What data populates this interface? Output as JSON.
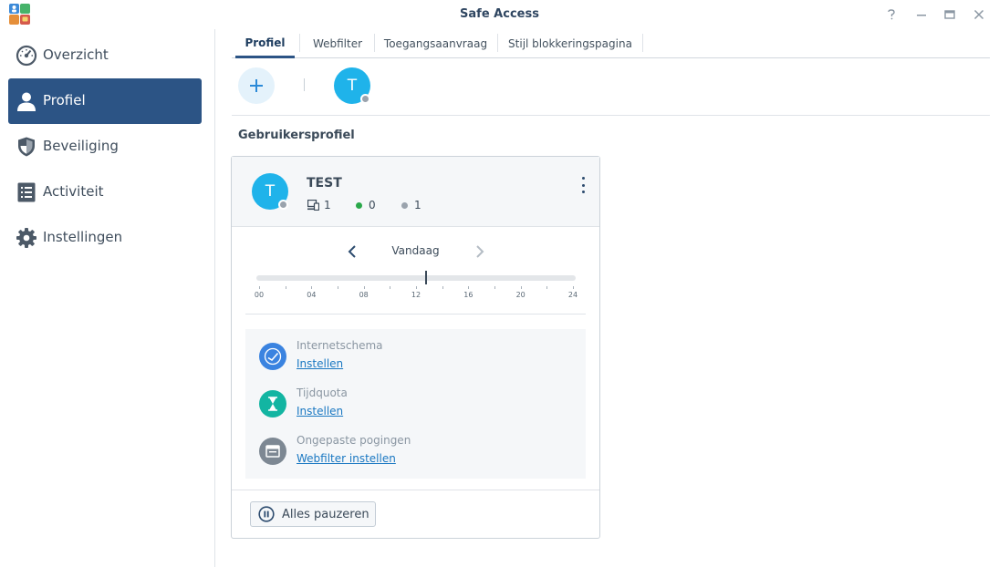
{
  "window": {
    "title": "Safe Access",
    "controls": [
      "help-icon",
      "minimize-icon",
      "maximize-icon",
      "close-icon"
    ]
  },
  "sidebar": {
    "items": [
      {
        "label": "Overzicht",
        "icon": "gauge-icon",
        "active": false
      },
      {
        "label": "Profiel",
        "icon": "user-icon",
        "active": true
      },
      {
        "label": "Beveiliging",
        "icon": "shield-icon",
        "active": false
      },
      {
        "label": "Activiteit",
        "icon": "list-icon",
        "active": false
      },
      {
        "label": "Instellingen",
        "icon": "gear-icon",
        "active": false
      }
    ]
  },
  "tabs": [
    {
      "label": "Profiel",
      "active": true
    },
    {
      "label": "Webfilter",
      "active": false
    },
    {
      "label": "Toegangsaanvraag",
      "active": false
    },
    {
      "label": "Stijl blokkeringspagina",
      "active": false
    }
  ],
  "profiles_strip": {
    "avatar_initial": "T",
    "status": "offline"
  },
  "section_title": "Gebruikersprofiel",
  "profile_card": {
    "initial": "T",
    "name": "TEST",
    "stats": {
      "devices": "1",
      "online": "0",
      "offline": "1"
    },
    "date_label": "Vandaag",
    "timeline_labels": [
      "00",
      "04",
      "08",
      "12",
      "16",
      "20",
      "24"
    ],
    "current_time_hours": 12.7,
    "rules": [
      {
        "title": "Internetschema",
        "link": "Instellen",
        "icon": "clock-icon"
      },
      {
        "title": "Tijdquota",
        "link": "Instellen",
        "icon": "hourglass-icon"
      },
      {
        "title": "Ongepaste pogingen",
        "link": "Webfilter instellen",
        "icon": "browser-window-icon"
      }
    ],
    "pause_button": "Alles pauzeren"
  },
  "colors": {
    "accent": "#2c5485",
    "avatar": "#1fb3ea",
    "online": "#2aa84a",
    "offline": "#9aa3ad",
    "link": "#1a78c2",
    "schedule_icon": "#3a83e0",
    "quota_icon": "#13b5a2",
    "filter_icon": "#7d8893"
  }
}
